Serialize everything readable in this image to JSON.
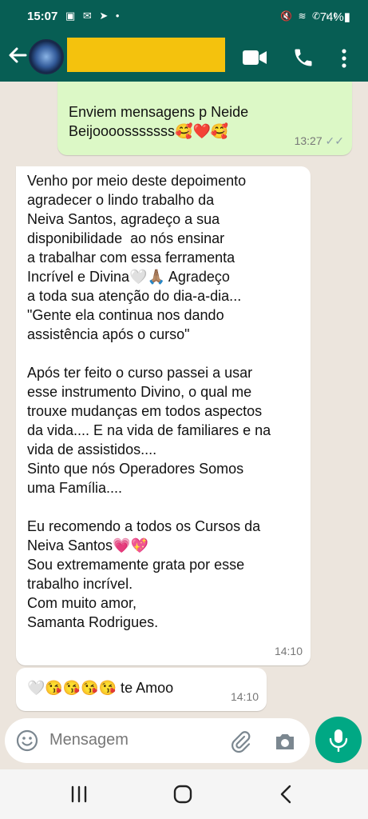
{
  "status": {
    "time": "15:07",
    "left_icons": "▣ ✉ ➤ •",
    "signal_icons": "🔇 ≋ ✆ ıll",
    "battery": "74%▮"
  },
  "header": {
    "back_icon": "arrow-left",
    "contact_name_hidden": true,
    "mask_color": "#f4c20d"
  },
  "messages": [
    {
      "direction": "out",
      "lines": [
        "Enviem mensagens p Neide",
        "Beijoooosssssss🥰❤️🥰"
      ],
      "time": "13:27",
      "ticks": "✓✓"
    },
    {
      "direction": "in",
      "paragraphs": [
        "Venho por meio deste depoimento\nagradecer o lindo trabalho da\nNeiva Santos, agradeço a sua\ndisponibilidade  ao nós ensinar\na trabalhar com essa ferramenta\nIncrível e Divina🤍🙏🏽 Agradeço\na toda sua atenção do dia-a-dia...\n\"Gente ela continua nos dando\nassistência após o curso\"",
        "Após ter feito o curso passei a usar\nesse instrumento Divino, o qual me\ntrouxe mudanças em todos aspectos\nda vida.... E na vida de familiares e na\nvida de assistidos....\nSinto que nós Operadores Somos\numa Família....",
        "Eu recomendo a todos os Cursos da\nNeiva Santos💗💖\nSou extremamente grata por esse\ntrabalho incrível.\nCom muito amor,\nSamanta Rodrigues."
      ],
      "time": "14:10"
    },
    {
      "direction": "in",
      "text": "🤍😘😘😘😘 te Amoo",
      "time": "14:10"
    }
  ],
  "input": {
    "placeholder": "Mensagem"
  },
  "colors": {
    "header": "#075e54",
    "outgoing": "#dcf8c6",
    "incoming": "#ffffff",
    "mic": "#00a884",
    "wallpaper": "#ece5dd"
  }
}
